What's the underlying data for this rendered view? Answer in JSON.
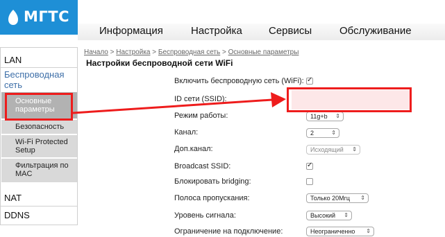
{
  "brand": {
    "name": "МГТС",
    "color": "#1e8fd6"
  },
  "topnav": [
    "Информация",
    "Настройка",
    "Сервисы",
    "Обслуживание"
  ],
  "sidebar": {
    "lan": "LAN",
    "wireless": "Беспроводная сеть",
    "subitems": [
      "Основные параметры",
      "Безопасность",
      "Wi-Fi Protected Setup",
      "Фильтрация по MAC"
    ],
    "active_subitem": "Основные параметры",
    "nat": "NAT",
    "ddns": "DDNS"
  },
  "breadcrumb": [
    "Начало",
    "Настройка",
    "Беспроводная сеть",
    "Основные параметры"
  ],
  "breadcrumb_separator": ">",
  "page_title": "Настройки беспроводной сети WiFi",
  "form": {
    "enable_wifi": {
      "label": "Включить беспроводную сеть (WiFi):",
      "checked": true
    },
    "ssid": {
      "label": "ID сети (SSID):",
      "value": ""
    },
    "mode": {
      "label": "Режим работы:",
      "value": "11g+b"
    },
    "channel": {
      "label": "Канал:",
      "value": "2"
    },
    "ext_channel": {
      "label": "Доп.канал:",
      "value": "Исходящий",
      "disabled": true
    },
    "broadcast_ssid": {
      "label": "Broadcast SSID:",
      "checked": true
    },
    "block_bridging": {
      "label": "Блокировать bridging:",
      "checked": false
    },
    "bandwidth": {
      "label": "Полоса пропускания:",
      "value": "Только 20Мгц"
    },
    "signal_level": {
      "label": "Уровень сигнала:",
      "value": "Высокий"
    },
    "connection_limit": {
      "label": "Ограничение на подключение:",
      "value": "Неограниченно"
    }
  },
  "annotation_color": "#ee1c1c",
  "icons": {
    "select_arrow": "up-down-chevron-icon",
    "checkmark": "checkmark-icon",
    "logo_mark": "egg-logo-icon"
  }
}
